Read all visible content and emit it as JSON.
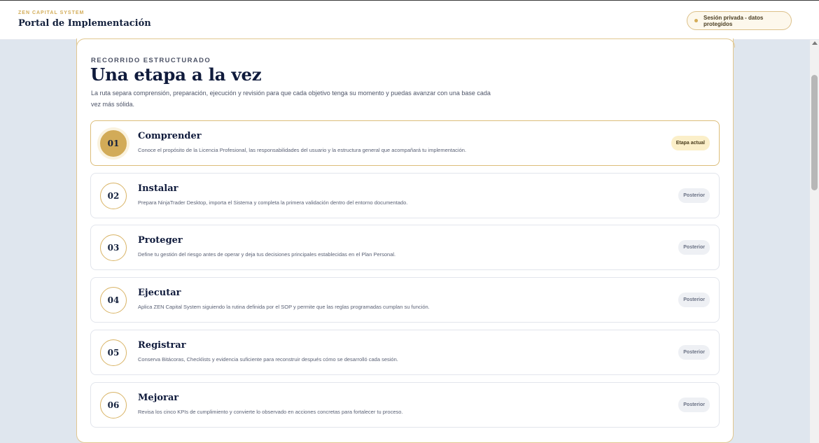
{
  "header": {
    "kicker": "ZEN CAPITAL SYSTEM",
    "title": "Portal de Implementación",
    "privacy_label": "Sesión privada - datos protegidos"
  },
  "section": {
    "kicker": "RECORRIDO ESTRUCTURADO",
    "title": "Una etapa a la vez",
    "description": "La ruta separa comprensión, preparación, ejecución y revisión para que cada objetivo tenga su momento y puedas avanzar con una base cada vez más sólida."
  },
  "steps": [
    {
      "number": "01",
      "title": "Comprender",
      "description": "Conoce el propósito de la Licencia Profesional, las responsabilidades del usuario y la estructura general que acompañará tu implementación.",
      "badge": "Etapa actual"
    },
    {
      "number": "02",
      "title": "Instalar",
      "description": "Prepara NinjaTrader Desktop, importa el Sistema y completa la primera validación dentro del entorno documentado.",
      "badge": "Posterior"
    },
    {
      "number": "03",
      "title": "Proteger",
      "description": "Define tu gestión del riesgo antes de operar y deja tus decisiones principales establecidas en el Plan Personal.",
      "badge": "Posterior"
    },
    {
      "number": "04",
      "title": "Ejecutar",
      "description": "Aplica ZEN Capital System siguiendo la rutina definida por el SOP y permite que las reglas programadas cumplan su función.",
      "badge": "Posterior"
    },
    {
      "number": "05",
      "title": "Registrar",
      "description": "Conserva Bitácoras, Checklists y evidencia suficiente para reconstruir después cómo se desarrolló cada sesión.",
      "badge": "Posterior"
    },
    {
      "number": "06",
      "title": "Mejorar",
      "description": "Revisa los cinco KPIs de cumplimiento y convierte lo observado en acciones concretas para fortalecer tu proceso.",
      "badge": "Posterior"
    }
  ],
  "colors": {
    "accent_gold": "#d2ab58",
    "navy": "#101b3c",
    "page_bg": "#dfe6ee"
  }
}
